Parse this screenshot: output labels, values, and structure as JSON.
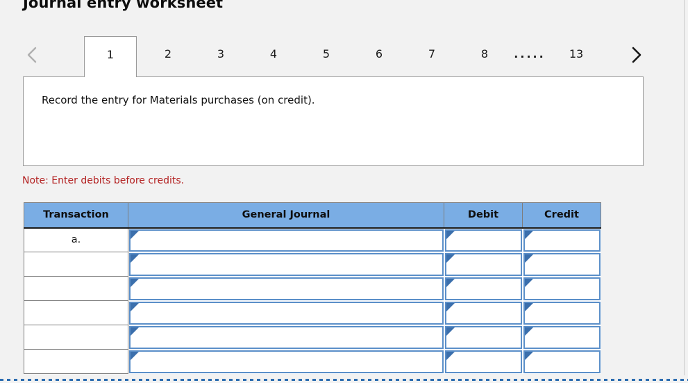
{
  "header": {
    "title": "Journal entry worksheet"
  },
  "pager": {
    "prev_icon": "chevron-left-icon",
    "next_icon": "chevron-right-icon",
    "prev_enabled": false,
    "next_enabled": true,
    "ellipsis": ".....",
    "tabs": [
      {
        "label": "1",
        "active": true
      },
      {
        "label": "2",
        "active": false
      },
      {
        "label": "3",
        "active": false
      },
      {
        "label": "4",
        "active": false
      },
      {
        "label": "5",
        "active": false
      },
      {
        "label": "6",
        "active": false
      },
      {
        "label": "7",
        "active": false
      },
      {
        "label": "8",
        "active": false
      },
      {
        "label": "13",
        "active": false
      }
    ]
  },
  "instruction": {
    "text": "Record the entry for Materials purchases (on credit)."
  },
  "note": {
    "text": "Note: Enter debits before credits.",
    "color": "#b32121"
  },
  "journal_table": {
    "columns": [
      "Transaction",
      "General Journal",
      "Debit",
      "Credit"
    ],
    "header_bg": "#7aade4",
    "field_border": "#5b8fc9",
    "rows": [
      {
        "transaction": "a.",
        "general_journal": "",
        "debit": "",
        "credit": ""
      },
      {
        "transaction": "",
        "general_journal": "",
        "debit": "",
        "credit": ""
      },
      {
        "transaction": "",
        "general_journal": "",
        "debit": "",
        "credit": ""
      },
      {
        "transaction": "",
        "general_journal": "",
        "debit": "",
        "credit": ""
      },
      {
        "transaction": "",
        "general_journal": "",
        "debit": "",
        "credit": ""
      },
      {
        "transaction": "",
        "general_journal": "",
        "debit": "",
        "credit": ""
      }
    ]
  }
}
